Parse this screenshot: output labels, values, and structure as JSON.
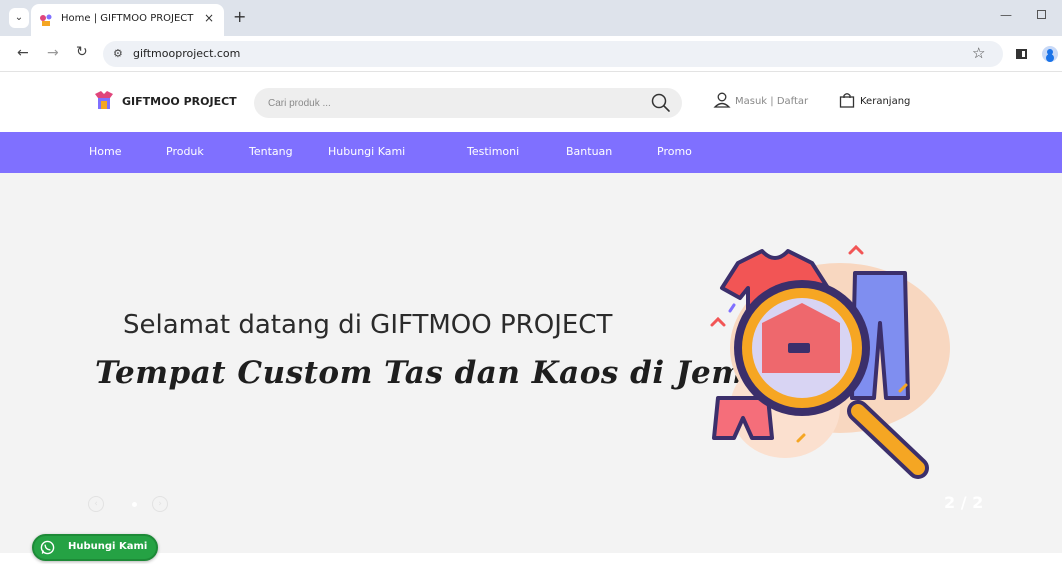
{
  "browser": {
    "tab_title": "Home | GIFTMOO PROJECT",
    "tab_close": "×",
    "new_tab": "+",
    "url": "giftmooproject.com"
  },
  "header": {
    "logo_text": "GIFTMOO PROJECT",
    "search_placeholder": "Cari produk ...",
    "login_text": "Masuk | Daftar",
    "cart_text": "Keranjang"
  },
  "nav": {
    "items": [
      "Home",
      "Produk",
      "Tentang",
      "Hubungi Kami",
      "Testimoni",
      "Bantuan",
      "Promo"
    ]
  },
  "hero": {
    "title": "Selamat datang di GIFTMOO PROJECT",
    "subtitle": "Tempat Custom Tas dan Kaos di Jember!",
    "counter": "2 / 2"
  },
  "whatsapp": {
    "label": "Hubungi Kami"
  },
  "colors": {
    "nav_bg": "#7f70ff",
    "whatsapp": "#25a244",
    "hero_bg": "#f3f3f3"
  }
}
